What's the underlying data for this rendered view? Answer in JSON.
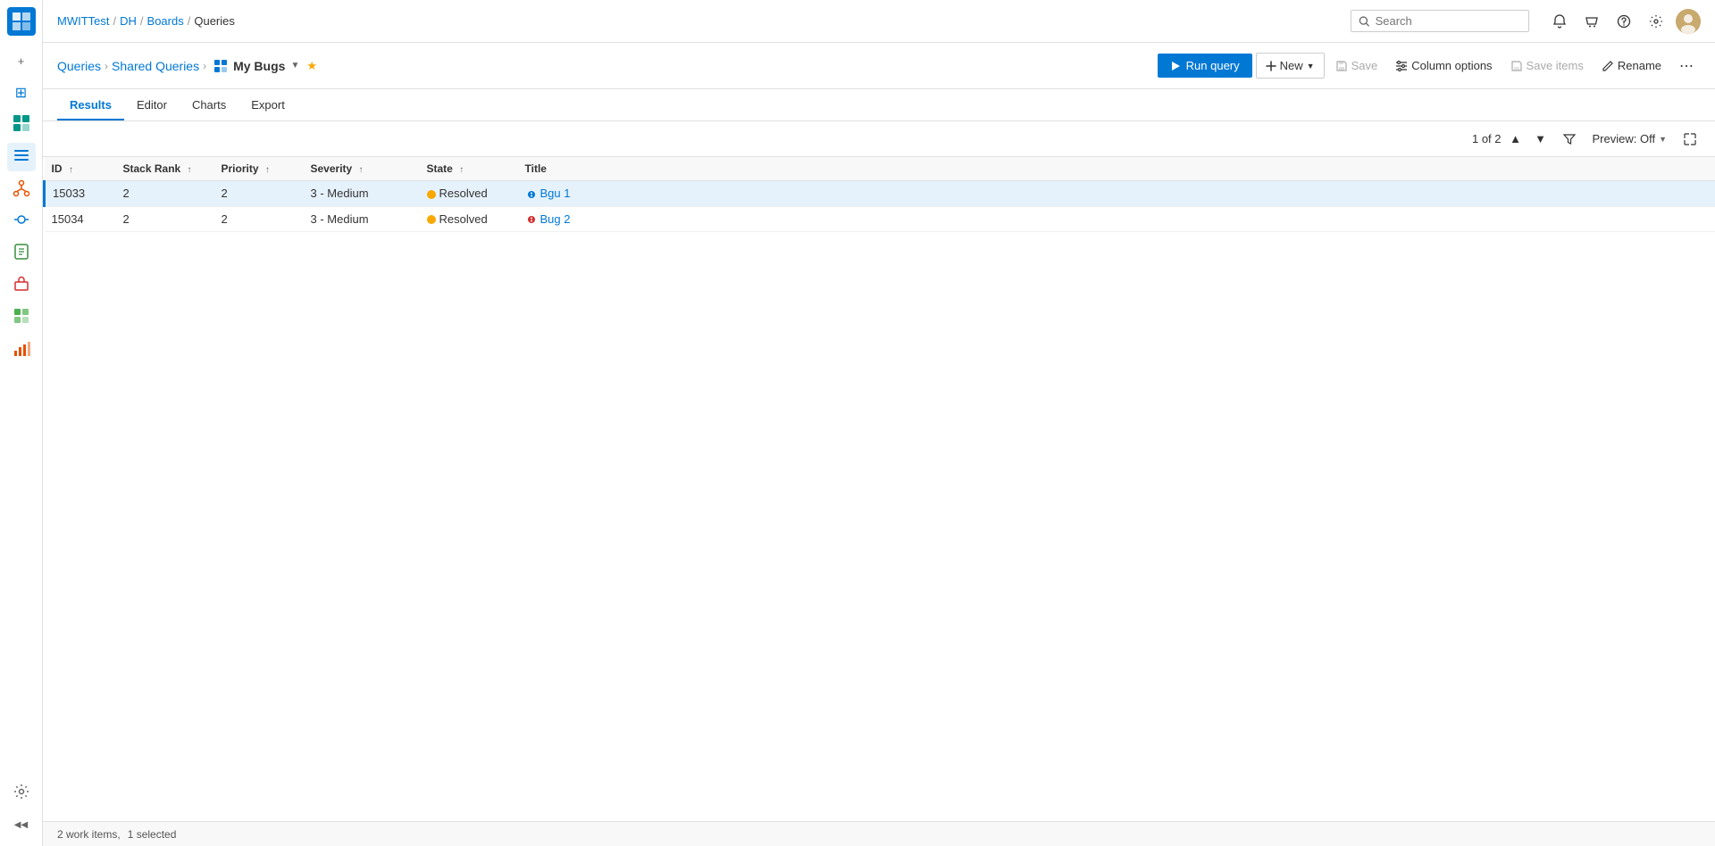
{
  "topbar": {
    "breadcrumbs": [
      "MWITTest",
      "DH",
      "Boards",
      "Queries"
    ],
    "search_placeholder": "Search"
  },
  "query_header": {
    "breadcrumb_queries": "Queries",
    "breadcrumb_shared": "Shared Queries",
    "query_name": "My Bugs",
    "run_label": "Run query",
    "new_label": "New",
    "save_label": "Save",
    "column_options_label": "Column options",
    "save_items_label": "Save items",
    "rename_label": "Rename"
  },
  "tabs": [
    "Results",
    "Editor",
    "Charts",
    "Export"
  ],
  "active_tab": "Results",
  "toolbar": {
    "pager_text": "1 of 2",
    "preview_label": "Preview: Off"
  },
  "table": {
    "columns": [
      {
        "key": "id",
        "label": "ID",
        "sort": "asc"
      },
      {
        "key": "stack_rank",
        "label": "Stack Rank",
        "sort": "asc"
      },
      {
        "key": "priority",
        "label": "Priority",
        "sort": "asc"
      },
      {
        "key": "severity",
        "label": "Severity",
        "sort": "asc"
      },
      {
        "key": "state",
        "label": "State",
        "sort": "asc"
      },
      {
        "key": "title",
        "label": "Title",
        "sort": null
      }
    ],
    "rows": [
      {
        "id": "15033",
        "stack_rank": "2",
        "priority": "2",
        "severity": "3 - Medium",
        "state": "Resolved",
        "title": "Bgu 1",
        "selected": true
      },
      {
        "id": "15034",
        "stack_rank": "2",
        "priority": "2",
        "severity": "3 - Medium",
        "state": "Resolved",
        "title": "Bug 2",
        "selected": false
      }
    ]
  },
  "status_bar": {
    "items_count": "2 work items,",
    "selected_text": "1 selected"
  },
  "sidebar": {
    "logo": "D",
    "items": [
      {
        "name": "overview",
        "icon": "⊞",
        "color": "icon-blue",
        "active": false
      },
      {
        "name": "boards",
        "icon": "⧉",
        "color": "icon-teal",
        "active": false
      },
      {
        "name": "work-items",
        "icon": "☰",
        "color": "icon-blue",
        "active": true
      },
      {
        "name": "repos",
        "icon": "⑂",
        "color": "icon-orange",
        "active": false
      },
      {
        "name": "pipelines",
        "icon": "◈",
        "color": "icon-blue",
        "active": false
      },
      {
        "name": "test-plans",
        "icon": "⬡",
        "color": "icon-green",
        "active": false
      },
      {
        "name": "artifacts",
        "icon": "❒",
        "color": "icon-red",
        "active": false
      },
      {
        "name": "extensions",
        "icon": "⊞",
        "color": "icon-green",
        "active": false
      },
      {
        "name": "analytics",
        "icon": "❏",
        "color": "icon-orange",
        "active": false
      },
      {
        "name": "extensions2",
        "icon": "⊕",
        "color": "icon-blue",
        "active": false
      }
    ]
  }
}
